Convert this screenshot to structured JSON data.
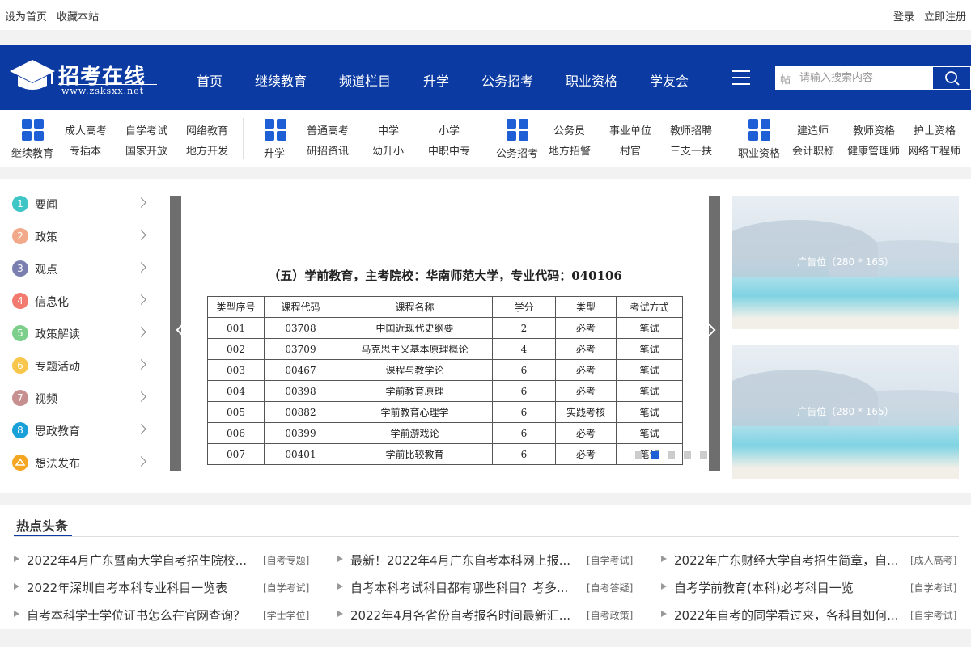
{
  "topbar": {
    "set_home": "设为首页",
    "bookmark": "收藏本站",
    "login": "登录",
    "register": "立即注册"
  },
  "header": {
    "logo_title": "招考在线",
    "logo_url": "www.zsksxx.net",
    "nav": [
      "首页",
      "继续教育",
      "频道栏目",
      "升学",
      "公务招考",
      "职业资格",
      "学友会"
    ],
    "search": {
      "type": "帖",
      "placeholder": "请输入搜索内容"
    }
  },
  "categories": [
    {
      "title": "继续教育",
      "links": [
        "成人高考",
        "自学考试",
        "网络教育",
        "专插本",
        "国家开放",
        "地方开发"
      ]
    },
    {
      "title": "升学",
      "links": [
        "普通高考",
        "中学",
        "小学",
        "研招资讯",
        "幼升小",
        "中职中专"
      ]
    },
    {
      "title": "公务招考",
      "links": [
        "公务员",
        "事业单位",
        "教师招聘",
        "地方招警",
        "村官",
        "三支一扶"
      ]
    },
    {
      "title": "职业资格",
      "links": [
        "建造师",
        "教师资格",
        "护士资格",
        "会计职称",
        "健康管理师",
        "网络工程师"
      ]
    }
  ],
  "sidebar": [
    {
      "num": "1",
      "label": "要闻",
      "color": "#3ec5c5"
    },
    {
      "num": "2",
      "label": "政策",
      "color": "#f2a98a"
    },
    {
      "num": "3",
      "label": "观点",
      "color": "#7b7fb0"
    },
    {
      "num": "4",
      "label": "信息化",
      "color": "#f27a6e"
    },
    {
      "num": "5",
      "label": "政策解读",
      "color": "#7ccf8a"
    },
    {
      "num": "6",
      "label": "专题活动",
      "color": "#f7c64a"
    },
    {
      "num": "7",
      "label": "视频",
      "color": "#c79090"
    },
    {
      "num": "8",
      "label": "思政教育",
      "color": "#1aa0d8"
    },
    {
      "num": "",
      "label": "想法发布",
      "color": "#f5a623"
    }
  ],
  "slide": {
    "title": "（五）学前教育，主考院校：华南师范大学，专业代码：040106",
    "headers": [
      "类型序号",
      "课程代码",
      "课程名称",
      "学分",
      "类型",
      "考试方式"
    ],
    "rows": [
      [
        "001",
        "03708",
        "中国近现代史纲要",
        "2",
        "必考",
        "笔试"
      ],
      [
        "002",
        "03709",
        "马克思主义基本原理概论",
        "4",
        "必考",
        "笔试"
      ],
      [
        "003",
        "00467",
        "课程与教学论",
        "6",
        "必考",
        "笔试"
      ],
      [
        "004",
        "00398",
        "学前教育原理",
        "6",
        "必考",
        "笔试"
      ],
      [
        "005",
        "00882",
        "学前教育心理学",
        "6",
        "实践考核",
        "笔试"
      ],
      [
        "006",
        "00399",
        "学前游戏论",
        "6",
        "必考",
        "笔试"
      ],
      [
        "007",
        "00401",
        "学前比较教育",
        "6",
        "必考",
        "笔试"
      ]
    ],
    "active_dot": 2,
    "dot_count": 5
  },
  "ads": [
    "广告位（280 * 165）",
    "广告位（280 * 165）"
  ],
  "hot": {
    "title": "热点头条",
    "items": [
      {
        "title": "2022年4月广东暨南大学自考招生院校...",
        "tag": "[自考专题]"
      },
      {
        "title": "最新！2022年4月广东自考本科网上报...",
        "tag": "[自学考试]"
      },
      {
        "title": "2022年广东财经大学自考招生简章，自...",
        "tag": "[成人高考]"
      },
      {
        "title": "2022年深圳自考本科专业科目一览表",
        "tag": "[自学考试]"
      },
      {
        "title": "自考本科考试科目都有哪些科目？考多...",
        "tag": "[自考答疑]"
      },
      {
        "title": "自考学前教育(本科)必考科目一览",
        "tag": "[自学考试]"
      },
      {
        "title": "自考本科学士学位证书怎么在官网查询？",
        "tag": "[学士学位]"
      },
      {
        "title": "2022年4月各省份自考报名时间最新汇...",
        "tag": "[自考政策]"
      },
      {
        "title": "2022年自考的同学看过来，各科目如何...",
        "tag": "[自学考试]"
      }
    ]
  }
}
